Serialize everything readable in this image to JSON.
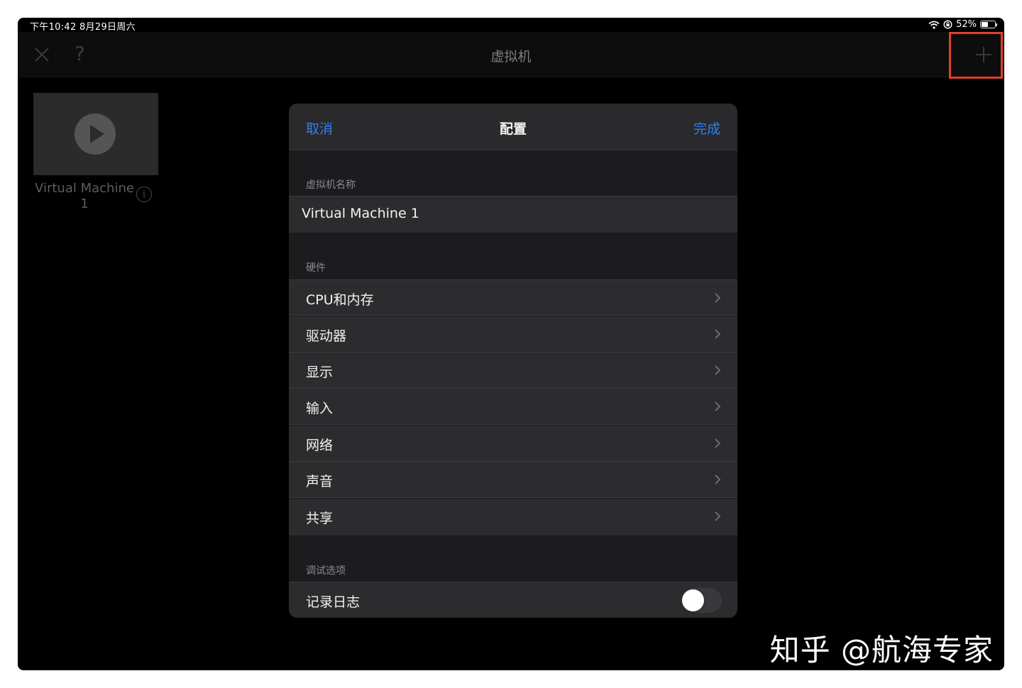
{
  "status_bar": {
    "time": "下午10:42   8月29日周六",
    "battery_percent": "52%",
    "battery_level": 0.52,
    "icons": [
      "wifi-icon",
      "orientation-lock-icon",
      "battery-icon"
    ]
  },
  "nav_bar": {
    "title": "虚拟机",
    "help_label": "?",
    "icons": [
      "close-icon",
      "help-icon",
      "add-icon"
    ],
    "highlight_color": "#e0402a"
  },
  "vm_card": {
    "name": "Virtual Machine 1",
    "info_label": "i"
  },
  "config_sheet": {
    "title": "配置",
    "cancel_label": "取消",
    "done_label": "完成",
    "accent_color": "#2f7ff2",
    "name_section_label": "虚拟机名称",
    "name_value": "Virtual Machine 1",
    "hardware_section_label": "硬件",
    "hardware_items": [
      {
        "label": "CPU和内存"
      },
      {
        "label": "驱动器"
      },
      {
        "label": "显示"
      },
      {
        "label": "输入"
      },
      {
        "label": "网络"
      },
      {
        "label": "声音"
      },
      {
        "label": "共享"
      }
    ],
    "debug_section_label": "调试选项",
    "debug_log_label": "记录日志",
    "debug_log_enabled": false
  },
  "watermark": "知乎 @航海专家"
}
